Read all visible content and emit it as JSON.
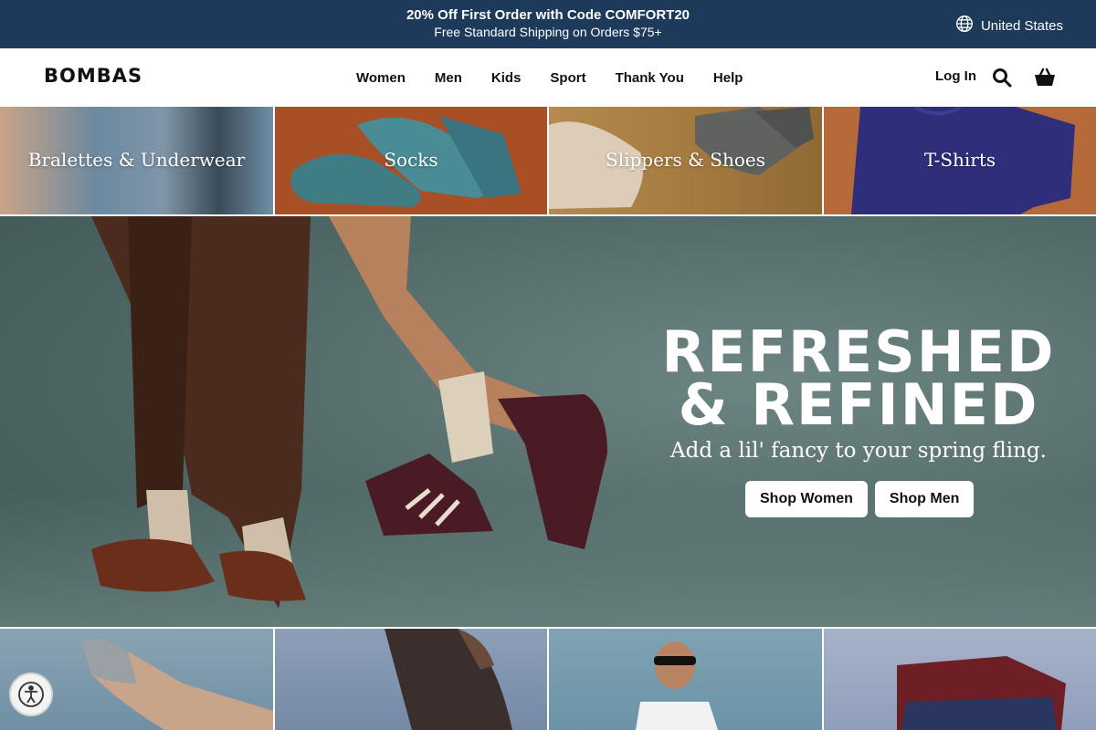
{
  "promo": {
    "line1": "20% Off First Order with Code COMFORT20",
    "line2": "Free Standard Shipping on Orders $75+",
    "region_label": "United States",
    "region_icon": "globe-icon",
    "background_color": "#1e3a5a"
  },
  "header": {
    "logo": "BOMBAS",
    "nav": [
      "Women",
      "Men",
      "Kids",
      "Sport",
      "Thank You",
      "Help"
    ],
    "login": "Log In",
    "search_icon": "search-icon",
    "cart_icon": "basket-icon"
  },
  "category_tiles": [
    {
      "label": "Bralettes & Underwear"
    },
    {
      "label": "Socks"
    },
    {
      "label": "Slippers & Shoes"
    },
    {
      "label": "T-Shirts"
    }
  ],
  "hero": {
    "title_line1": "REFRESHED",
    "title_line2": "& REFINED",
    "subtitle": "Add a lil' fancy to your spring fling.",
    "button_women": "Shop Women",
    "button_men": "Shop Men"
  },
  "accessibility": {
    "icon": "accessibility-icon"
  }
}
